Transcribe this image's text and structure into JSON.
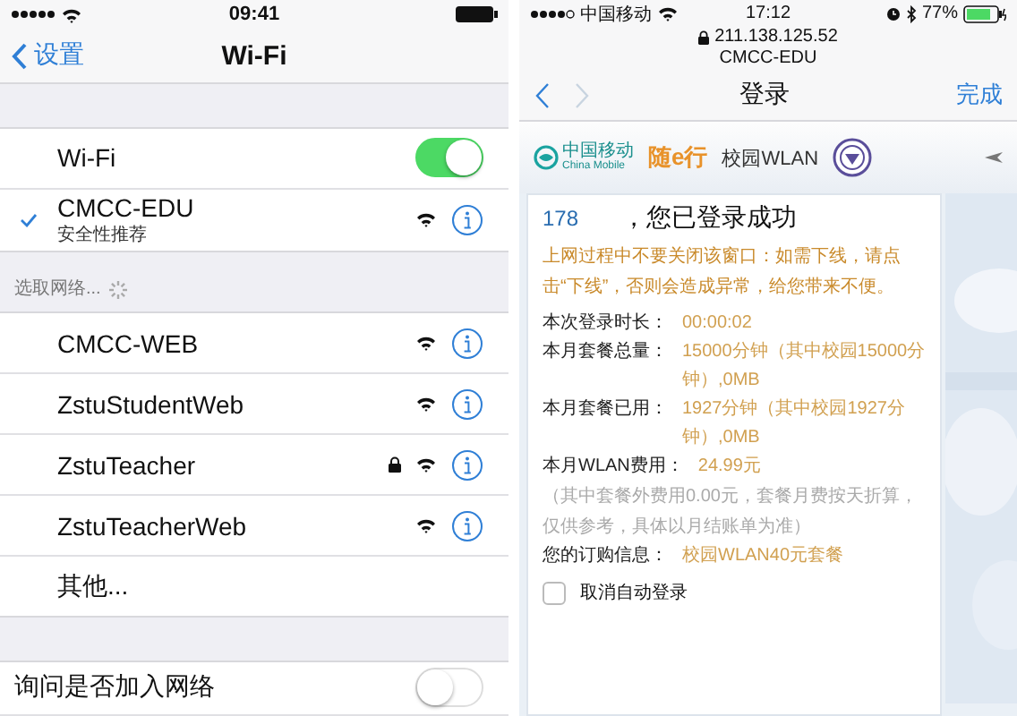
{
  "left": {
    "status_bar": {
      "time": "09:41"
    },
    "nav": {
      "back": "设置",
      "title": "Wi-Fi"
    },
    "wifi": {
      "label": "Wi-Fi",
      "on": true
    },
    "connected": {
      "name": "CMCC-EDU",
      "subtitle": "安全性推荐",
      "selected": true
    },
    "section_header": "选取网络...",
    "networks": [
      {
        "name": "CMCC-WEB",
        "locked": false
      },
      {
        "name": "ZstuStudentWeb",
        "locked": false
      },
      {
        "name": "ZstuTeacher",
        "locked": true
      },
      {
        "name": "ZstuTeacherWeb",
        "locked": false
      }
    ],
    "other": "其他...",
    "ask_join": {
      "label": "询问是否加入网络",
      "on": false
    }
  },
  "right": {
    "status_bar": {
      "carrier": "中国移动",
      "time": "17:12",
      "battery": "77%"
    },
    "address": "211.138.125.52",
    "ssid": "CMCC-EDU",
    "nav": {
      "title": "登录",
      "done": "完成"
    },
    "banner": {
      "brand": "中国移动",
      "brand_en": "China Mobile",
      "slogan": "随e行",
      "campus": "校园WLAN"
    },
    "card": {
      "user": "178",
      "success": "，您已登录成功",
      "notice": "上网过程中不要关闭该窗口：如需下线，请点击“下线”，否则会造成异常，给您带来不便。",
      "details": [
        {
          "label": "本次登录时长：",
          "value": "00:00:02"
        },
        {
          "label": "本月套餐总量：",
          "value": "15000分钟（其中校园15000分钟）,0MB"
        },
        {
          "label": "本月套餐已用：",
          "value": "1927分钟（其中校园1927分钟）,0MB"
        },
        {
          "label": "本月WLAN费用：",
          "value": "24.99元"
        }
      ],
      "fee_note": "（其中套餐外费用0.00元，套餐月费按天折算，仅供参考，具体以月结账单为准）",
      "subscription": {
        "label": "您的订购信息：",
        "value": "校园WLAN40元套餐"
      },
      "auto_login": {
        "label": "取消自动登录",
        "checked": false
      }
    }
  }
}
